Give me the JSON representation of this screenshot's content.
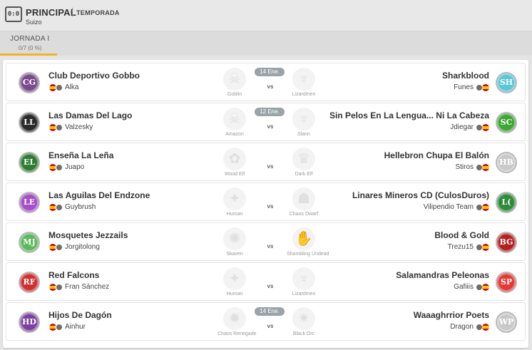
{
  "header": {
    "logo": "0:0",
    "title": "PRINCIPAL",
    "season": "TEMPORADA",
    "subtitle": "Suizo"
  },
  "tab": {
    "label": "JORNADA I",
    "progress": "0/7 (0 %)"
  },
  "matches": [
    {
      "date": "14 Ene.",
      "vs": "vs",
      "home": {
        "name": "Club Deportivo Gobbo",
        "coach": "Alka",
        "race": "Goblin",
        "badge": "CG",
        "color": "#7a4a8c"
      },
      "away": {
        "name": "Sharkblood",
        "coach": "Funes",
        "race": "Lizardmen",
        "badge": "SH",
        "color": "#5bc6d6"
      }
    },
    {
      "date": "12 Ene.",
      "vs": "vs",
      "home": {
        "name": "Las Damas Del Lago",
        "coach": "Valzesky",
        "race": "Amazon",
        "badge": "LL",
        "color": "#2b2b2b"
      },
      "away": {
        "name": "Sin Pelos En La Lengua... Ni La Cabeza",
        "coach": "Jdiegar",
        "race": "Slann",
        "badge": "SC",
        "color": "#3fa535"
      }
    },
    {
      "date": "",
      "vs": "vs",
      "home": {
        "name": "Enseña La Leña",
        "coach": "Juapo",
        "race": "Wood Elf",
        "badge": "EL",
        "color": "#2e7d32"
      },
      "away": {
        "name": "Hellebron Chupa El Balón",
        "coach": "Stiros",
        "race": "Dark Elf",
        "badge": "HB",
        "color": "#c9c9c9"
      }
    },
    {
      "date": "",
      "vs": "vs",
      "home": {
        "name": "Las Aguilas Del Endzone",
        "coach": "Guybrush",
        "race": "Human",
        "badge": "LE",
        "color": "#a64fc9"
      },
      "away": {
        "name": "Linares Mineros CD (CulosDuros)",
        "coach": "Vilipendio Team",
        "race": "Chaos Dwarf",
        "badge": "L(",
        "color": "#2e8b3a"
      }
    },
    {
      "date": "",
      "vs": "vs",
      "home": {
        "name": "Mosquetes Jezzails",
        "coach": "Jorgitolong",
        "race": "Skaven",
        "badge": "MJ",
        "color": "#5cb85c"
      },
      "away": {
        "name": "Blood & Gold",
        "coach": "Trezu15",
        "race": "Shambling Undead",
        "badge": "BG",
        "color": "#b51f1f"
      }
    },
    {
      "date": "",
      "vs": "vs",
      "home": {
        "name": "Red Falcons",
        "coach": "Fran Sánchez",
        "race": "Human",
        "badge": "RF",
        "color": "#d32f2f"
      },
      "away": {
        "name": "Salamandras Peleonas",
        "coach": "Gafiiis",
        "race": "Lizardmen",
        "badge": "SP",
        "color": "#e53935"
      }
    },
    {
      "date": "14 Ene.",
      "vs": "vs",
      "home": {
        "name": "Hijos De Dagón",
        "coach": "Ainhur",
        "race": "Chaos Renegade",
        "badge": "HD",
        "color": "#7b3fa0"
      },
      "away": {
        "name": "Waaaghrrior Poets",
        "coach": "Dragon",
        "race": "Black Orc",
        "badge": "WP",
        "color": "#c9c9c9"
      }
    }
  ]
}
